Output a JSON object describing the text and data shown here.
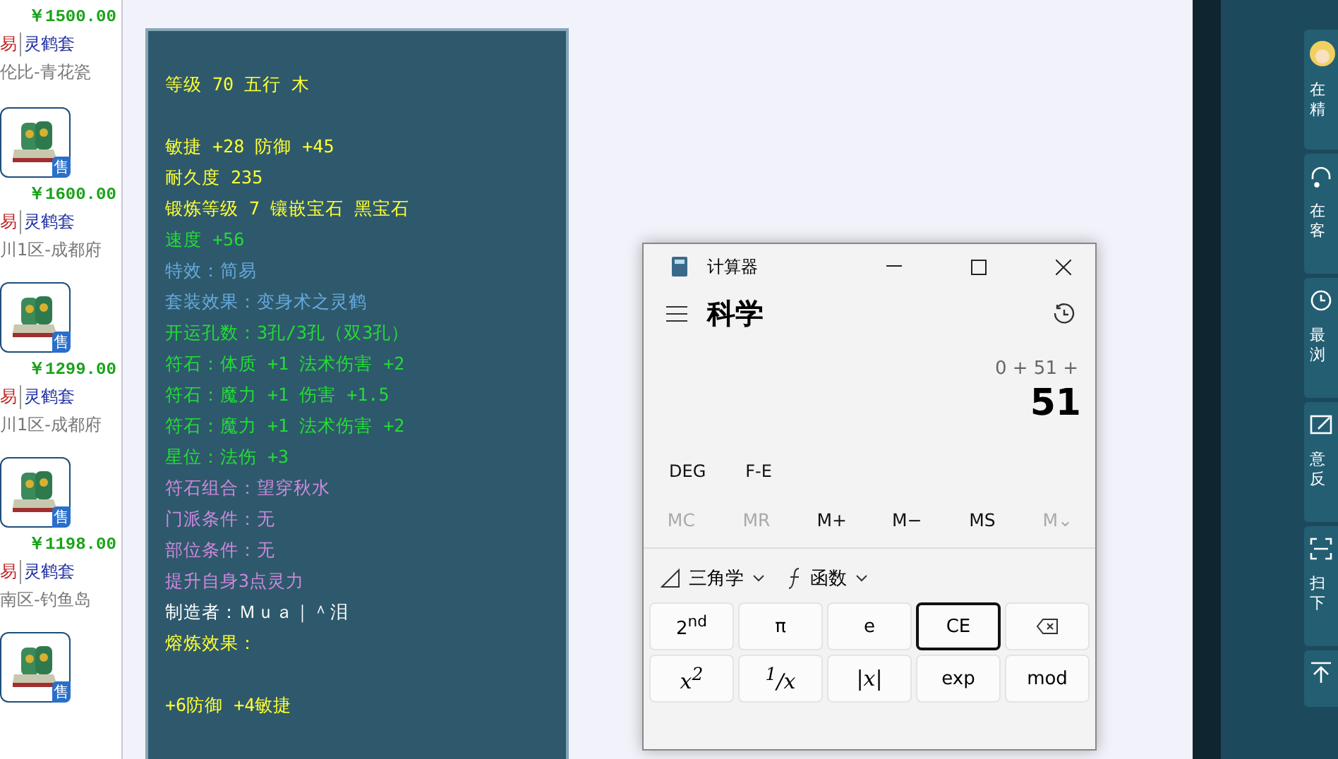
{
  "listings": [
    {
      "has_image": false,
      "price": "￥1500.00",
      "trade": "易",
      "set": "灵鹤套",
      "server": "伦比-青花瓷"
    },
    {
      "has_image": true,
      "badge": "售",
      "price": "￥1600.00",
      "trade": "易",
      "set": "灵鹤套",
      "server": "川1区-成都府"
    },
    {
      "has_image": true,
      "badge": "售",
      "price": "￥1299.00",
      "trade": "易",
      "set": "灵鹤套",
      "server": "川1区-成都府"
    },
    {
      "has_image": true,
      "badge": "售",
      "price": "￥1198.00",
      "trade": "易",
      "set": "灵鹤套",
      "server": "南区-钓鱼岛"
    },
    {
      "has_image": true,
      "badge": "售"
    }
  ],
  "tooltip": {
    "blocks": [
      {
        "lines": [
          {
            "text": "等级 70 五行 木",
            "color": "#ffff33"
          }
        ]
      },
      {
        "lines": [
          {
            "text": "敏捷 +28 防御 +45",
            "color": "#ffff33"
          },
          {
            "text": "耐久度 235",
            "color": "#ffff33"
          },
          {
            "text": "锻炼等级 7 镶嵌宝石 黑宝石",
            "color": "#ffff33"
          },
          {
            "text": "速度 +56",
            "color": "#22dd33"
          },
          {
            "text": "特效：简易",
            "color": "#66aadd"
          },
          {
            "text": "套装效果：变身术之灵鹤",
            "color": "#66aadd"
          },
          {
            "text": "开运孔数：3孔/3孔（双3孔）",
            "color": "#22dd33"
          },
          {
            "text": "符石：体质 +1 法术伤害 +2",
            "color": "#22dd33"
          },
          {
            "text": "符石：魔力 +1 伤害 +1.5",
            "color": "#22dd33"
          },
          {
            "text": "符石：魔力 +1 法术伤害 +2",
            "color": "#22dd33"
          },
          {
            "text": "星位：法伤 +3",
            "color": "#22dd33"
          },
          {
            "text": "符石组合：望穿秋水",
            "color": "#cc88dd"
          },
          {
            "text": "门派条件：无",
            "color": "#cc88dd"
          },
          {
            "text": "部位条件：无",
            "color": "#cc88dd"
          },
          {
            "text": "提升自身3点灵力",
            "color": "#cc88dd"
          },
          {
            "text": "制造者：Ｍｕａ｜＾泪",
            "color": "#ffffff"
          },
          {
            "text": "熔炼效果：",
            "color": "#ffff33"
          }
        ]
      },
      {
        "lines": [
          {
            "text": "+6防御 +4敏捷",
            "color": "#ffff33"
          }
        ]
      }
    ]
  },
  "calculator": {
    "title": "计算器",
    "mode": "科学",
    "expression": "0 + 51 +",
    "display": "51",
    "settings": [
      "DEG",
      "F-E"
    ],
    "memory": [
      {
        "label": "MC",
        "disabled": true
      },
      {
        "label": "MR",
        "disabled": true
      },
      {
        "label": "M+",
        "disabled": false
      },
      {
        "label": "M−",
        "disabled": false
      },
      {
        "label": "MS",
        "disabled": false
      },
      {
        "label": "M⌄",
        "disabled": true
      }
    ],
    "menus": [
      {
        "kind": "trig",
        "label": "三角学"
      },
      {
        "kind": "func",
        "label": "函数"
      }
    ],
    "keys": [
      {
        "kind": "text",
        "label": "2$^{nd}$",
        "focused": false
      },
      {
        "kind": "text",
        "label": "π",
        "focused": false
      },
      {
        "kind": "text",
        "label": "e",
        "focused": false
      },
      {
        "kind": "text",
        "label": "CE",
        "focused": true
      },
      {
        "kind": "backspace",
        "focused": false
      },
      {
        "kind": "math",
        "label": "x$^{2}$",
        "focused": false
      },
      {
        "kind": "math",
        "label": "$^{1}$/x",
        "focused": false
      },
      {
        "kind": "math",
        "label": "|x|",
        "focused": false
      },
      {
        "kind": "text",
        "label": "exp",
        "focused": false
      },
      {
        "kind": "text",
        "label": "mod",
        "focused": false
      }
    ]
  },
  "side_panel": [
    {
      "kind": "avatar",
      "lines": [
        "在",
        "精"
      ]
    },
    {
      "kind": "headset",
      "lines": [
        "在",
        "客"
      ]
    },
    {
      "kind": "clock",
      "lines": [
        "最",
        "浏"
      ]
    },
    {
      "kind": "edit",
      "lines": [
        "意",
        "反"
      ]
    },
    {
      "kind": "scan",
      "lines": [
        "扫",
        "下"
      ]
    },
    {
      "kind": "top"
    }
  ]
}
